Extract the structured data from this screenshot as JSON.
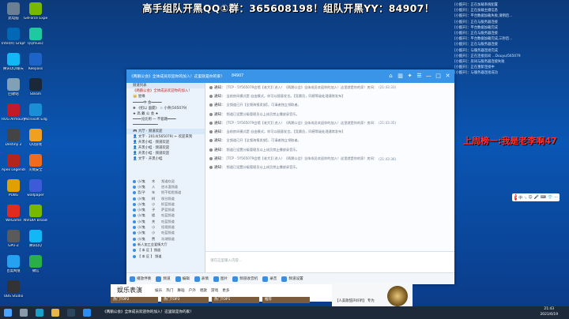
{
  "banner": "高手组队开黑QQ①群：365608198！组队开黑YY：84907！",
  "desktop_icons": [
    {
      "label": "此电脑"
    },
    {
      "label": "GeForce Experience"
    },
    {
      "label": "Intel(R) Graphics..."
    },
    {
      "label": "QQmusic"
    },
    {
      "label": "腾讯QQ/聊天"
    },
    {
      "label": "Keepass"
    },
    {
      "label": "回收站"
    },
    {
      "label": "Steam"
    },
    {
      "label": "ROG Armoury"
    },
    {
      "label": "Microsoft Edge"
    },
    {
      "label": "Destiny 2"
    },
    {
      "label": "QQ游戏"
    },
    {
      "label": "Apex Legends"
    },
    {
      "label": "火绒安全"
    },
    {
      "label": "PUBG"
    },
    {
      "label": "wallpaper"
    },
    {
      "label": "WeGame"
    },
    {
      "label": "NVIDIA Broadcast"
    },
    {
      "label": "GPU-Z"
    },
    {
      "label": "腾讯QQ"
    },
    {
      "label": "百度网盘"
    },
    {
      "label": "微信"
    },
    {
      "label": "OBS Studio"
    }
  ],
  "right_log": [
    "[小酷开]：正在加载系统配置",
    "[小酷开]：正在加载主播信息",
    "[小酷开]：平台数据加载失败,请稍后...",
    "[小酷开]：正在与服务器连接",
    "[小酷开]：平台数据加载完成",
    "[小酷开]：正在与服务器连接",
    "[小酷开]：平台数据加载完成,三秒后...",
    "[小酷开]：正在与服务器连接",
    "[小酷开]：与服务器连接完成",
    "[小酷开]：正在连接房间 ...Douyu/565079",
    "[小酷开]：房间与服务器连接失败",
    "[小酷开]：正在重新连接中",
    "[小酷开]：与服务器连接成功"
  ],
  "rank_text": "上周榜一:我是老李啊47",
  "ime": {
    "badge": "S",
    "items": [
      "中",
      "·,",
      "☺",
      "🎤",
      "⌨",
      "👕",
      "⋯"
    ]
  },
  "qt": {
    "title": "《两鹅公会》全体成员欢迎你的加入！这里就是你的家！",
    "room_id": "84907",
    "sidebar": [
      {
        "text": "频道列表",
        "style": "head"
      },
      {
        "text": "《两鹅公会》全体成员欢迎你的加入！",
        "style": "red"
      },
      {
        "text": "👑 星缘",
        "style": ""
      },
      {
        "text": "━━━━━中 会━━━━━",
        "style": ""
      },
      {
        "text": "❀ 《招以 面厦》 ☆ 小骨(565079)",
        "style": ""
      },
      {
        "text": "★ 高 戴 公 会 ★",
        "style": ""
      },
      {
        "text": "━━━━兑比例 一 不套路━━━━",
        "style": ""
      },
      {
        "text": "━━━━━━━━━━━━",
        "style": ""
      },
      {
        "text": "🎮 大厅 · 频道欢迎",
        "style": "head"
      },
      {
        "text": "👤 文字 · 2014(565079) ← 欢迎来到",
        "style": ""
      },
      {
        "text": "👤 开黑小蛙 · 频道欢迎",
        "style": ""
      },
      {
        "text": "👤 开黑小蛙 · 频道欢迎",
        "style": ""
      },
      {
        "text": "👤 开黑小蛙 · 频道欢迎",
        "style": ""
      },
      {
        "text": "👤 文字 · 开黑小蛙",
        "style": ""
      }
    ],
    "members": [
      {
        "a": "小/鬼",
        "b": "木",
        "c": "频道欢迎"
      },
      {
        "a": "小/鬼",
        "b": "人",
        "c": "逆水温频道"
      },
      {
        "a": "音/子",
        "b": "年",
        "c": "恨不相思频道"
      },
      {
        "a": "小/鬼",
        "b": "树",
        "c": "咲谷频道"
      },
      {
        "a": "小/鬼",
        "b": "小",
        "c": "抓蓝频道"
      },
      {
        "a": "小/鬼",
        "b": "子",
        "c": "萨蓝频道"
      },
      {
        "a": "小/鬼",
        "b": "楼",
        "c": "吃蓝频道"
      },
      {
        "a": "小/鬼",
        "b": "关",
        "c": "吃蓝频道"
      },
      {
        "a": "小/鬼",
        "b": "小",
        "c": "短视频道"
      },
      {
        "a": "小/鬼",
        "b": "小",
        "c": "吃蓝频道"
      },
      {
        "a": "小/鬼",
        "b": "费",
        "c": "冻湖频道"
      },
      {
        "a": "新人加工会爱情大厅",
        "b": "",
        "c": ""
      },
      {
        "a": "【 本 区 】频道",
        "b": "",
        "c": ""
      },
      {
        "a": "【 本 区 】 频道",
        "b": "",
        "c": ""
      }
    ],
    "chat": [
      {
        "sys": "通知：",
        "msg": "[TCP - 5Y565079会馆【老大】] 进入！《两鹅公会》全体成员欢迎你的加入！这里就是你的家！房间：",
        "time": "(21:43:33)"
      },
      {
        "sys": "通知：",
        "msg": "当前房间模式是 自由模式，你可以随意发言。【竞赛员，同感等级处理通常发布】",
        "time": ""
      },
      {
        "sys": "通知：",
        "msg": "全频道已开【全频海报发放】，可请者独立领取者。",
        "time": ""
      },
      {
        "sys": "通知：",
        "msg": "频道已设置分级管理员以上成员禁止播放录音乐。",
        "time": ""
      },
      {
        "sys": "通知：",
        "msg": "[TCP - 5Y565079会馆【老大】] 进入！《两鹅公会》全体成员欢迎你的加入！这里就是你的家！房间：",
        "time": "(21:43:35)"
      },
      {
        "sys": "通知：",
        "msg": "当前房间模式是 自由模式，你可以随意发言。【竞赛员，同感等级处理通常发布】",
        "time": ""
      },
      {
        "sys": "通知：",
        "msg": "全频道已开【全频海报发放】，可请者独立领取者。",
        "time": ""
      },
      {
        "sys": "通知：",
        "msg": "频道已设置分级管理员以上成员禁止播放录音乐。",
        "time": ""
      },
      {
        "sys": "通知：",
        "msg": "[TCP - 5Y565079会馆【老大】] 进入！《两鹅公会》全体成员欢迎你的加入！这里就是你的家！房间：",
        "time": "(21:43:36)"
      },
      {
        "sys": "通知：",
        "msg": "频道已设置分级管理员以上成员禁止播放录音乐。",
        "time": ""
      }
    ],
    "input_placeholder": "请在这里输入内容...",
    "send_label": "发送"
  },
  "bottom_bar": [
    "播放伴奏",
    "频道",
    "编辑",
    "表情",
    "图片",
    "频道收音机",
    "录音",
    "频道设置"
  ],
  "ent": {
    "title": "娱乐表演",
    "tabs": [
      "娱乐",
      "热门",
      "舞蹈",
      "户外",
      "唱歌",
      "游戏",
      "更多"
    ],
    "thumbs": [
      "热门TOP2",
      "热门TOP3",
      "热门TOP1",
      "推荐"
    ]
  },
  "video": {
    "label": "【人美歌甜声好听】 专为"
  },
  "taskbar_task": "《两鹅公会》全体成员欢迎你的加入！这里就是你的家！",
  "clock": {
    "time": "21:43",
    "date": "2021/6/19"
  }
}
